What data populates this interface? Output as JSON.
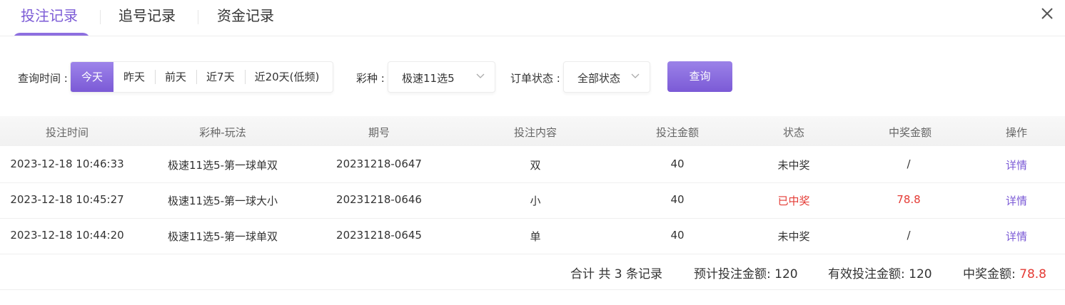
{
  "tabs": [
    {
      "label": "投注记录",
      "active": true
    },
    {
      "label": "追号记录",
      "active": false
    },
    {
      "label": "资金记录",
      "active": false
    }
  ],
  "colors": {
    "accent": "#7b5ad6",
    "win": "#e43b35"
  },
  "filters": {
    "time_label": "查询时间 :",
    "date_options": [
      {
        "label": "今天",
        "active": true
      },
      {
        "label": "昨天",
        "active": false
      },
      {
        "label": "前天",
        "active": false
      },
      {
        "label": "近7天",
        "active": false
      },
      {
        "label": "近20天(低频)",
        "active": false
      }
    ],
    "lottery_label": "彩种 :",
    "lottery_value": "极速11选5",
    "status_label": "订单状态 :",
    "status_value": "全部状态",
    "query_label": "查询"
  },
  "table": {
    "headers": [
      "投注时间",
      "彩种-玩法",
      "期号",
      "投注内容",
      "投注金额",
      "状态",
      "中奖金额",
      "操作"
    ],
    "rows": [
      {
        "time": "2023-12-18 10:46:33",
        "game": "极速11选5-第一球单双",
        "issue": "20231218-0647",
        "content": "双",
        "amount": "40",
        "status": "未中奖",
        "won": false,
        "prize": "/",
        "action": "详情"
      },
      {
        "time": "2023-12-18 10:45:27",
        "game": "极速11选5-第一球大小",
        "issue": "20231218-0646",
        "content": "小",
        "amount": "40",
        "status": "已中奖",
        "won": true,
        "prize": "78.8",
        "action": "详情"
      },
      {
        "time": "2023-12-18 10:44:20",
        "game": "极速11选5-第一球单双",
        "issue": "20231218-0645",
        "content": "单",
        "amount": "40",
        "status": "未中奖",
        "won": false,
        "prize": "/",
        "action": "详情"
      }
    ]
  },
  "summary": {
    "total_text": "合计 共 3 条记录",
    "expected_label": "预计投注金额:",
    "expected_value": "120",
    "valid_label": "有效投注金额:",
    "valid_value": "120",
    "prize_label": "中奖金额:",
    "prize_value": "78.8"
  }
}
